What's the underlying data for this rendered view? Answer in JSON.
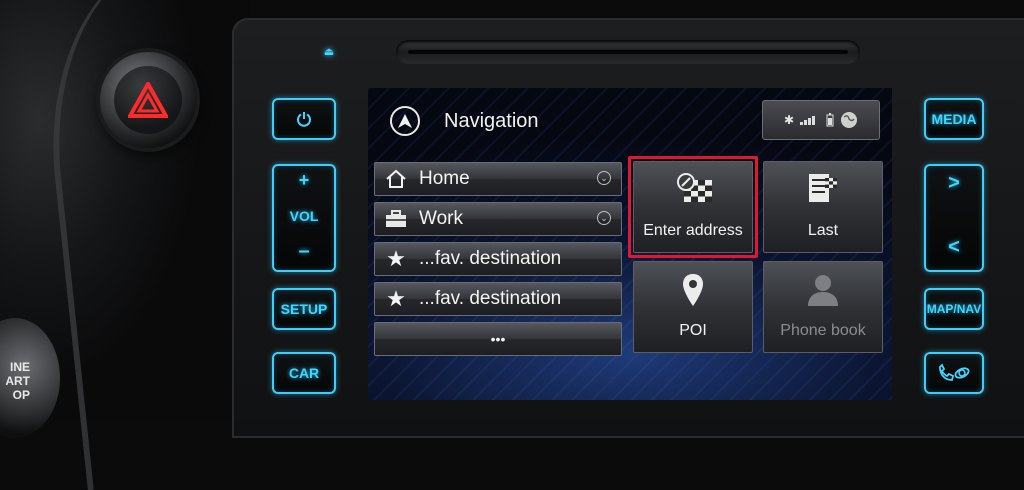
{
  "colors": {
    "accent": "#3fd6ff",
    "highlight": "#e0182e"
  },
  "left_panel": {
    "engine_label_lines": [
      "INE",
      "ART",
      "OP"
    ]
  },
  "buttons_left": {
    "power_icon": "power-icon",
    "vol_label": "VOL",
    "vol_plus": "+",
    "vol_minus": "–",
    "setup": "SETUP",
    "car": "CAR"
  },
  "buttons_right": {
    "media": "MEDIA",
    "next": ">",
    "prev": "<",
    "map_nav": "MAP/NAV",
    "phone_icon": "phone-icon"
  },
  "screen": {
    "title": "Navigation",
    "status": {
      "bluetooth": "bluetooth-icon",
      "signal": "signal-icon",
      "battery": "battery-icon",
      "globe": "globe-icon"
    },
    "list": [
      {
        "label": "Home",
        "icon": "home-icon",
        "has_chevron": true
      },
      {
        "label": "Work",
        "icon": "briefcase-icon",
        "has_chevron": true
      },
      {
        "label": "...fav. destination",
        "icon": "star-icon",
        "has_chevron": false
      },
      {
        "label": "...fav. destination",
        "icon": "star-icon",
        "has_chevron": false
      }
    ],
    "more_label": "•••",
    "tiles": [
      {
        "label": "Enter address",
        "icon": "flag-map-icon",
        "selected": true
      },
      {
        "label": "Last",
        "icon": "last-destinations-icon",
        "selected": false
      },
      {
        "label": "POI",
        "icon": "map-pin-icon",
        "selected": false
      },
      {
        "label": "Phone book",
        "icon": "contact-icon",
        "selected": false,
        "disabled": true
      }
    ]
  }
}
